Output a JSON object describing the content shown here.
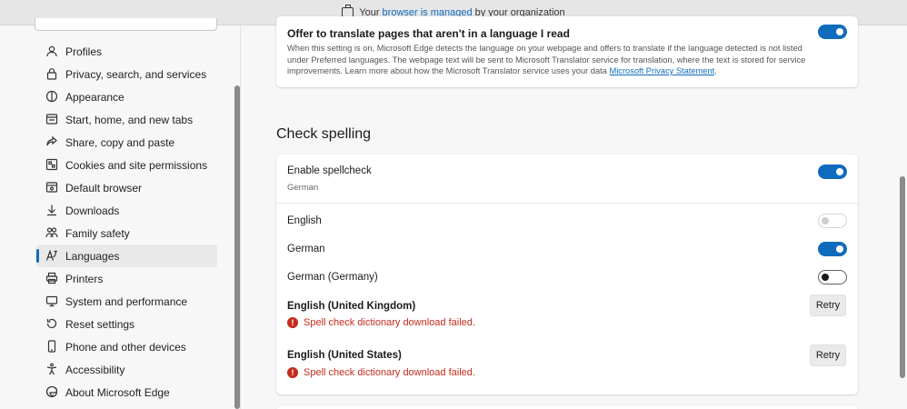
{
  "banner": {
    "prefix": "Your",
    "link": "browser is managed",
    "suffix": "by your organization"
  },
  "sidebar": {
    "items": [
      {
        "label": "Profiles",
        "icon": "profile-icon"
      },
      {
        "label": "Privacy, search, and services",
        "icon": "lock-icon"
      },
      {
        "label": "Appearance",
        "icon": "appearance-icon"
      },
      {
        "label": "Start, home, and new tabs",
        "icon": "start-home-icon"
      },
      {
        "label": "Share, copy and paste",
        "icon": "share-icon"
      },
      {
        "label": "Cookies and site permissions",
        "icon": "cookies-icon"
      },
      {
        "label": "Default browser",
        "icon": "default-browser-icon"
      },
      {
        "label": "Downloads",
        "icon": "download-icon"
      },
      {
        "label": "Family safety",
        "icon": "family-icon"
      },
      {
        "label": "Languages",
        "icon": "languages-icon",
        "active": true
      },
      {
        "label": "Printers",
        "icon": "printer-icon"
      },
      {
        "label": "System and performance",
        "icon": "system-icon"
      },
      {
        "label": "Reset settings",
        "icon": "reset-icon"
      },
      {
        "label": "Phone and other devices",
        "icon": "phone-icon"
      },
      {
        "label": "Accessibility",
        "icon": "accessibility-icon"
      },
      {
        "label": "About Microsoft Edge",
        "icon": "edge-icon"
      }
    ]
  },
  "translate": {
    "title": "Offer to translate pages that aren't in a language I read",
    "description": "When this setting is on, Microsoft Edge detects the language on your webpage and offers to translate if the language detected is not listed under Preferred languages. The webpage text will be sent to Microsoft Translator service for translation, where the text is stored for service improvements. Learn more about how the Microsoft Translator service uses your data",
    "link": "Microsoft Privacy Statement",
    "link_suffix": ".",
    "enabled": true
  },
  "spelling": {
    "section_title": "Check spelling",
    "enable_label": "Enable spellcheck",
    "enable_sub": "German",
    "enable_on": true,
    "languages": [
      {
        "label": "English",
        "state": "disabled"
      },
      {
        "label": "German",
        "state": "on"
      },
      {
        "label": "German (Germany)",
        "state": "off"
      }
    ],
    "failed": [
      {
        "label": "English (United Kingdom)",
        "error": "Spell check dictionary download failed.",
        "button": "Retry"
      },
      {
        "label": "English (United States)",
        "error": "Spell check dictionary download failed.",
        "button": "Retry"
      }
    ]
  },
  "colors": {
    "accent": "#0f6cbd",
    "error": "#c42b1c"
  }
}
